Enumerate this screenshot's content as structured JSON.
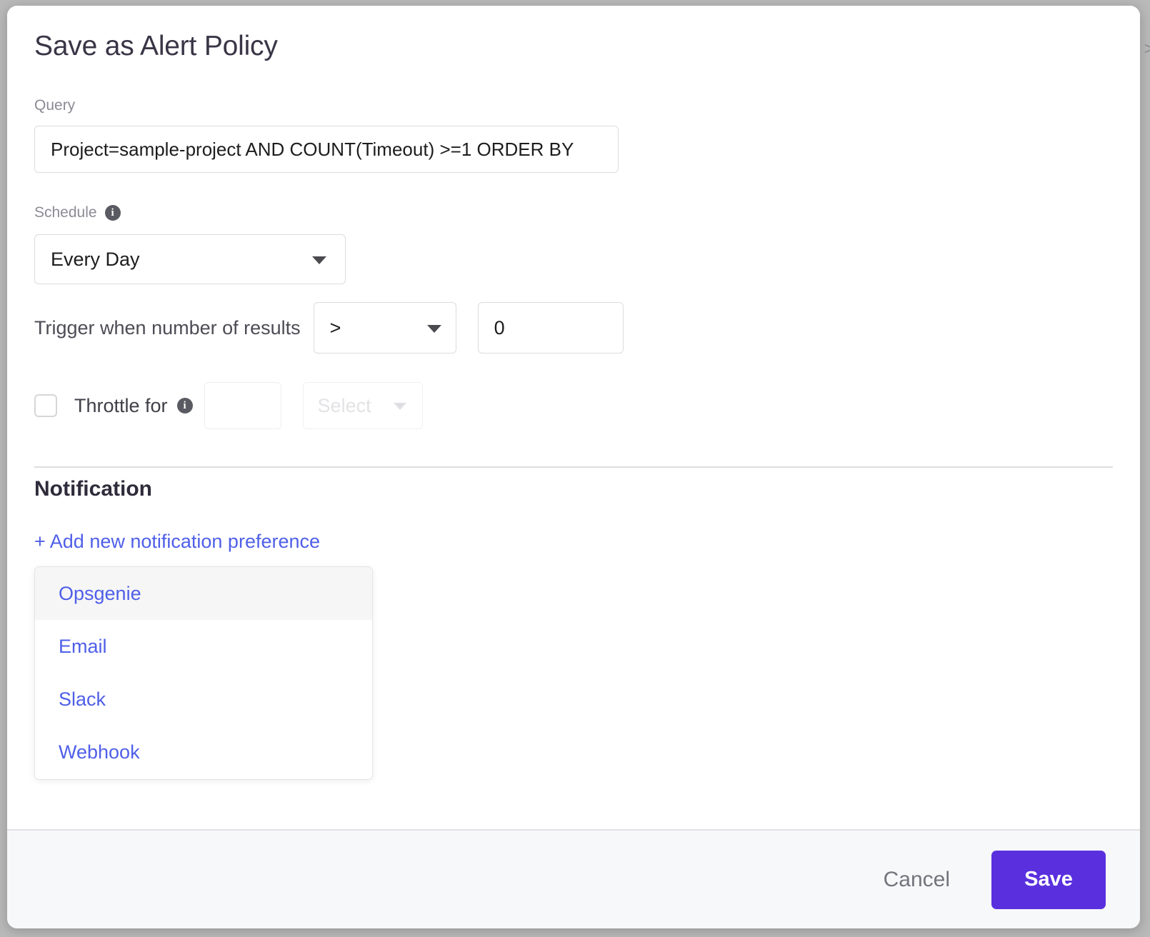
{
  "dialog": {
    "title": "Save as Alert Policy"
  },
  "query": {
    "label": "Query",
    "value": "Project=sample-project AND COUNT(Timeout) >=1 ORDER BY",
    "placeholder": "Query"
  },
  "schedule": {
    "label": "Schedule",
    "info_icon": "info-icon",
    "selected": "Every Day",
    "caret_icon": "chevron-down-icon"
  },
  "trigger": {
    "label": "Trigger when number of results",
    "operator": ">",
    "operator_caret_icon": "chevron-down-icon",
    "threshold": "0",
    "threshold_placeholder": "0"
  },
  "throttle": {
    "checkbox_icon": "checkbox-unchecked-icon",
    "checked": false,
    "label": "Throttle for",
    "info_icon": "info-icon",
    "amount": "",
    "amount_placeholder": "",
    "unit_placeholder": "Select",
    "unit_caret_icon": "chevron-down-icon"
  },
  "notification": {
    "heading": "Notification",
    "add_link": "+ Add new notification preference",
    "options": [
      {
        "label": "Opsgenie",
        "active": true
      },
      {
        "label": "Email",
        "active": false
      },
      {
        "label": "Slack",
        "active": false
      },
      {
        "label": "Webhook",
        "active": false
      }
    ]
  },
  "footer": {
    "cancel_label": "Cancel",
    "save_label": "Save"
  },
  "colors": {
    "accent_purple": "#5a30de",
    "link_blue": "#4f5fe8",
    "border_gray": "#dcdcdf",
    "footer_bg": "#f7f8fa",
    "hover_bg": "#f6f6f7"
  },
  "edge": {
    "sliver": ">"
  }
}
